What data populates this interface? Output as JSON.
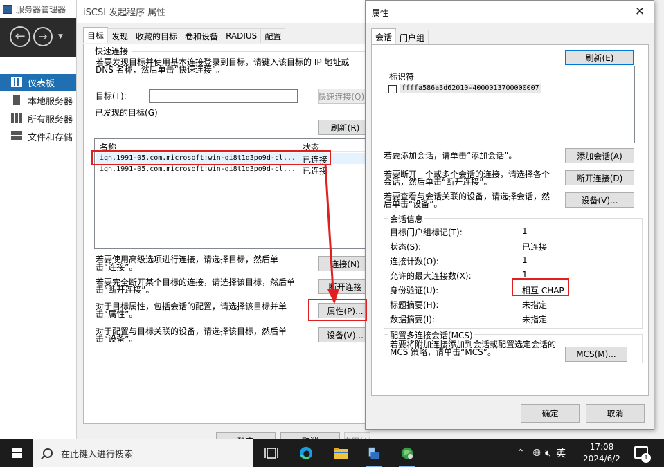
{
  "server_manager": {
    "title": "服务器管理器",
    "sidebar": [
      {
        "label": "仪表板",
        "icon": "dashboard-icon",
        "active": true
      },
      {
        "label": "本地服务器",
        "icon": "local-server-icon",
        "active": false
      },
      {
        "label": "所有服务器",
        "icon": "all-servers-icon",
        "active": false
      },
      {
        "label": "文件和存储",
        "icon": "file-storage-icon",
        "active": false
      }
    ]
  },
  "iscsi": {
    "title": "iSCSI 发起程序 属性",
    "tabs": [
      "目标",
      "发现",
      "收藏的目标",
      "卷和设备",
      "RADIUS",
      "配置"
    ],
    "quick_connect": {
      "group_label": "快速连接",
      "description": "若要发现目标并使用基本连接登录到目标，请键入该目标的 IP 地址或 DNS 名称，然后单击“快速连接”。",
      "target_label": "目标(T):",
      "target_value": "",
      "button": "快速连接(Q)..."
    },
    "discovered": {
      "group_label": "已发现的目标(G)",
      "refresh_button": "刷新(R)",
      "columns": [
        "名称",
        "状态"
      ],
      "rows": [
        {
          "name": "iqn.1991-05.com.microsoft:win-qi8t1q3po9d-cl...",
          "status": "已连接"
        },
        {
          "name": "iqn.1991-05.com.microsoft:win-qi8t1q3po9d-cl...",
          "status": "已连接"
        }
      ]
    },
    "actions": [
      {
        "text": "若要使用高级选项进行连接，请选择目标，然后单击“连接”。",
        "button": "连接(N)"
      },
      {
        "text": "若要完全断开某个目标的连接，请选择该目标，然后单击“断开连接”。",
        "button": "断开连接"
      },
      {
        "text": "对于目标属性，包括会话的配置，请选择该目标并单击“属性”。",
        "button": "属性(P)..."
      },
      {
        "text": "对于配置与目标关联的设备，请选择该目标，然后单击“设备”。",
        "button": "设备(V)..."
      }
    ],
    "footer_buttons": [
      "确定",
      "取消",
      "应用(A)"
    ]
  },
  "props": {
    "title": "属性",
    "tabs": [
      "会话",
      "门户组"
    ],
    "refresh_button": "刷新(E)",
    "session_header": "标识符",
    "session_id": "ffffa586a3d62010-4000013700000007",
    "session_actions": [
      {
        "text": "若要添加会话，请单击“添加会话”。",
        "button": "添加会话(A)"
      },
      {
        "text": "若要断开一个或多个会话的连接，请选择各个会话，然后单击“断开连接”。",
        "button": "断开连接(D)"
      },
      {
        "text": "若要查看与会话关联的设备，请选择会话，然后单击“设备”。",
        "button": "设备(V)..."
      }
    ],
    "session_info": {
      "group_label": "会话信息",
      "rows": [
        {
          "label": "目标门户组标记(T):",
          "value": "1"
        },
        {
          "label": "状态(S):",
          "value": "已连接"
        },
        {
          "label": "连接计数(O):",
          "value": "1"
        },
        {
          "label": "允许的最大连接数(X):",
          "value": "1"
        },
        {
          "label": "身份验证(U):",
          "value": "相互 CHAP"
        },
        {
          "label": "标题摘要(H):",
          "value": "未指定"
        },
        {
          "label": "数据摘要(I):",
          "value": "未指定"
        }
      ]
    },
    "mcs": {
      "group_label": "配置多连接会话(MCS)",
      "text": "若要将附加连接添加到会话或配置选定会话的 MCS 策略，请单击“MCS”。",
      "button": "MCS(M)..."
    },
    "ok_button": "确定",
    "cancel_button": "取消"
  },
  "taskbar": {
    "search_placeholder": "在此键入进行搜索",
    "ime": "英",
    "time": "17:08",
    "date": "2024/6/2",
    "notifications": "1"
  },
  "colors": {
    "accent": "#1f6fb2",
    "annotation": "#e02020",
    "taskbar": "#1c1c1c"
  }
}
